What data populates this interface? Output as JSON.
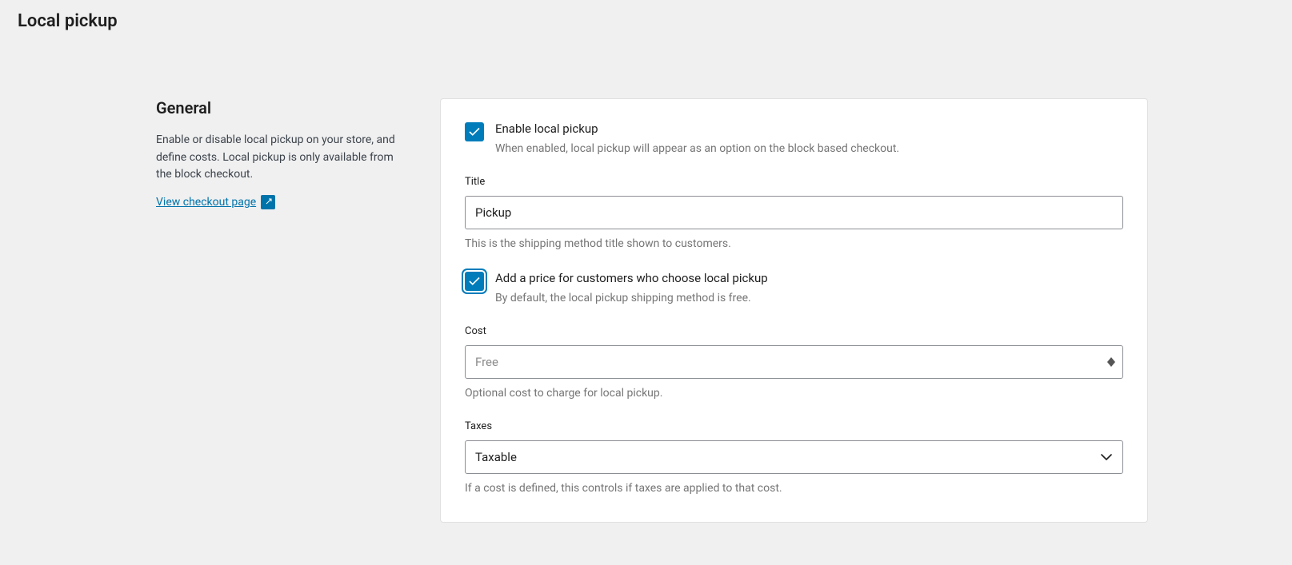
{
  "page": {
    "title": "Local pickup"
  },
  "sidebar": {
    "heading": "General",
    "description": "Enable or disable local pickup on your store, and define costs. Local pickup is only available from the block checkout.",
    "link_label": "View checkout page"
  },
  "form": {
    "enable": {
      "label": "Enable local pickup",
      "help": "When enabled, local pickup will appear as an option on the block based checkout.",
      "checked": true
    },
    "title": {
      "label": "Title",
      "value": "Pickup",
      "help": "This is the shipping method title shown to customers."
    },
    "add_price": {
      "label": "Add a price for customers who choose local pickup",
      "help": "By default, the local pickup shipping method is free.",
      "checked": true
    },
    "cost": {
      "label": "Cost",
      "placeholder": "Free",
      "value": "",
      "help": "Optional cost to charge for local pickup."
    },
    "taxes": {
      "label": "Taxes",
      "value": "Taxable",
      "help": "If a cost is defined, this controls if taxes are applied to that cost."
    }
  }
}
